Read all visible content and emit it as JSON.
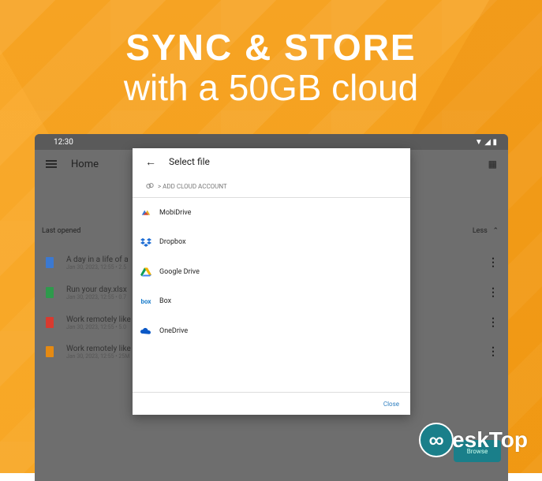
{
  "headline": {
    "line1": "SYNC & STORE",
    "line2": "with a 50GB cloud"
  },
  "statusbar": {
    "time": "12:30"
  },
  "appbar": {
    "title": "Home"
  },
  "section": {
    "title": "Last opened",
    "toggle": "Less"
  },
  "files": [
    {
      "name": "A day in a life of a",
      "meta": "Jan 30, 2023, 12:55 • 2.5",
      "color": "#3b79d1"
    },
    {
      "name": "Run your day.xlsx",
      "meta": "Jan 30, 2023, 12:55 • 0.7",
      "color": "#2e9a4c"
    },
    {
      "name": "Work remotely like",
      "meta": "Jan 30, 2023, 12:55 • 5.0",
      "color": "#d83a2f"
    },
    {
      "name": "Work remotely like",
      "meta": "Jan 30, 2023, 12:55 • 25M",
      "color": "#e58a12"
    }
  ],
  "dialog": {
    "title": "Select file",
    "add_cloud": "> ADD CLOUD ACCOUNT",
    "providers": [
      {
        "label": "MobiDrive",
        "icon": "mobidrive-icon"
      },
      {
        "label": "Dropbox",
        "icon": "dropbox-icon"
      },
      {
        "label": "Google Drive",
        "icon": "google-drive-icon"
      },
      {
        "label": "Box",
        "icon": "box-icon"
      },
      {
        "label": "OneDrive",
        "icon": "onedrive-icon"
      }
    ],
    "close_label": "Close"
  },
  "browse_label": "Browse",
  "watermark": {
    "text": "eskTop"
  }
}
